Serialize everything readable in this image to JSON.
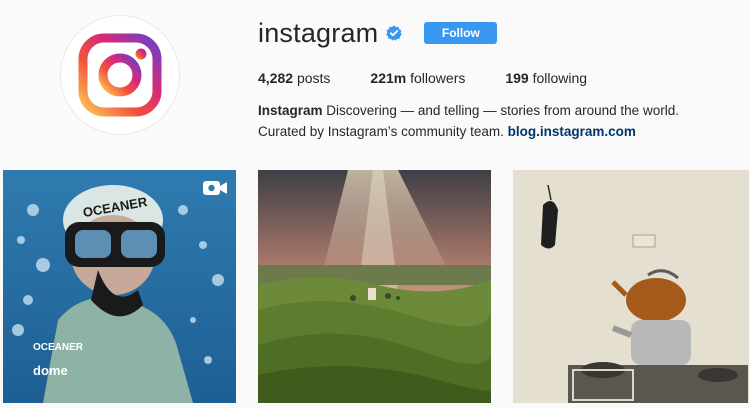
{
  "profile": {
    "username": "instagram",
    "follow_label": "Follow",
    "stats": [
      {
        "count": "4,282",
        "label": "posts"
      },
      {
        "count": "221m",
        "label": "followers"
      },
      {
        "count": "199",
        "label": "following"
      }
    ],
    "bio": {
      "name": "Instagram",
      "text": "Discovering — and telling — stories from around the world. Curated by Instagram’s community team.",
      "link": "blog.instagram.com"
    }
  },
  "posts": [
    {
      "kind": "video",
      "subject": "free diver underwater",
      "caption_text": [
        "OCEANER",
        "OCEANER",
        "dome"
      ]
    },
    {
      "kind": "photo",
      "subject": "rolling hills at sunset"
    },
    {
      "kind": "photo",
      "subject": "teapot on stove"
    }
  ],
  "colors": {
    "accent": "#3897f0",
    "link": "#003569",
    "verified": "#3897f0"
  }
}
